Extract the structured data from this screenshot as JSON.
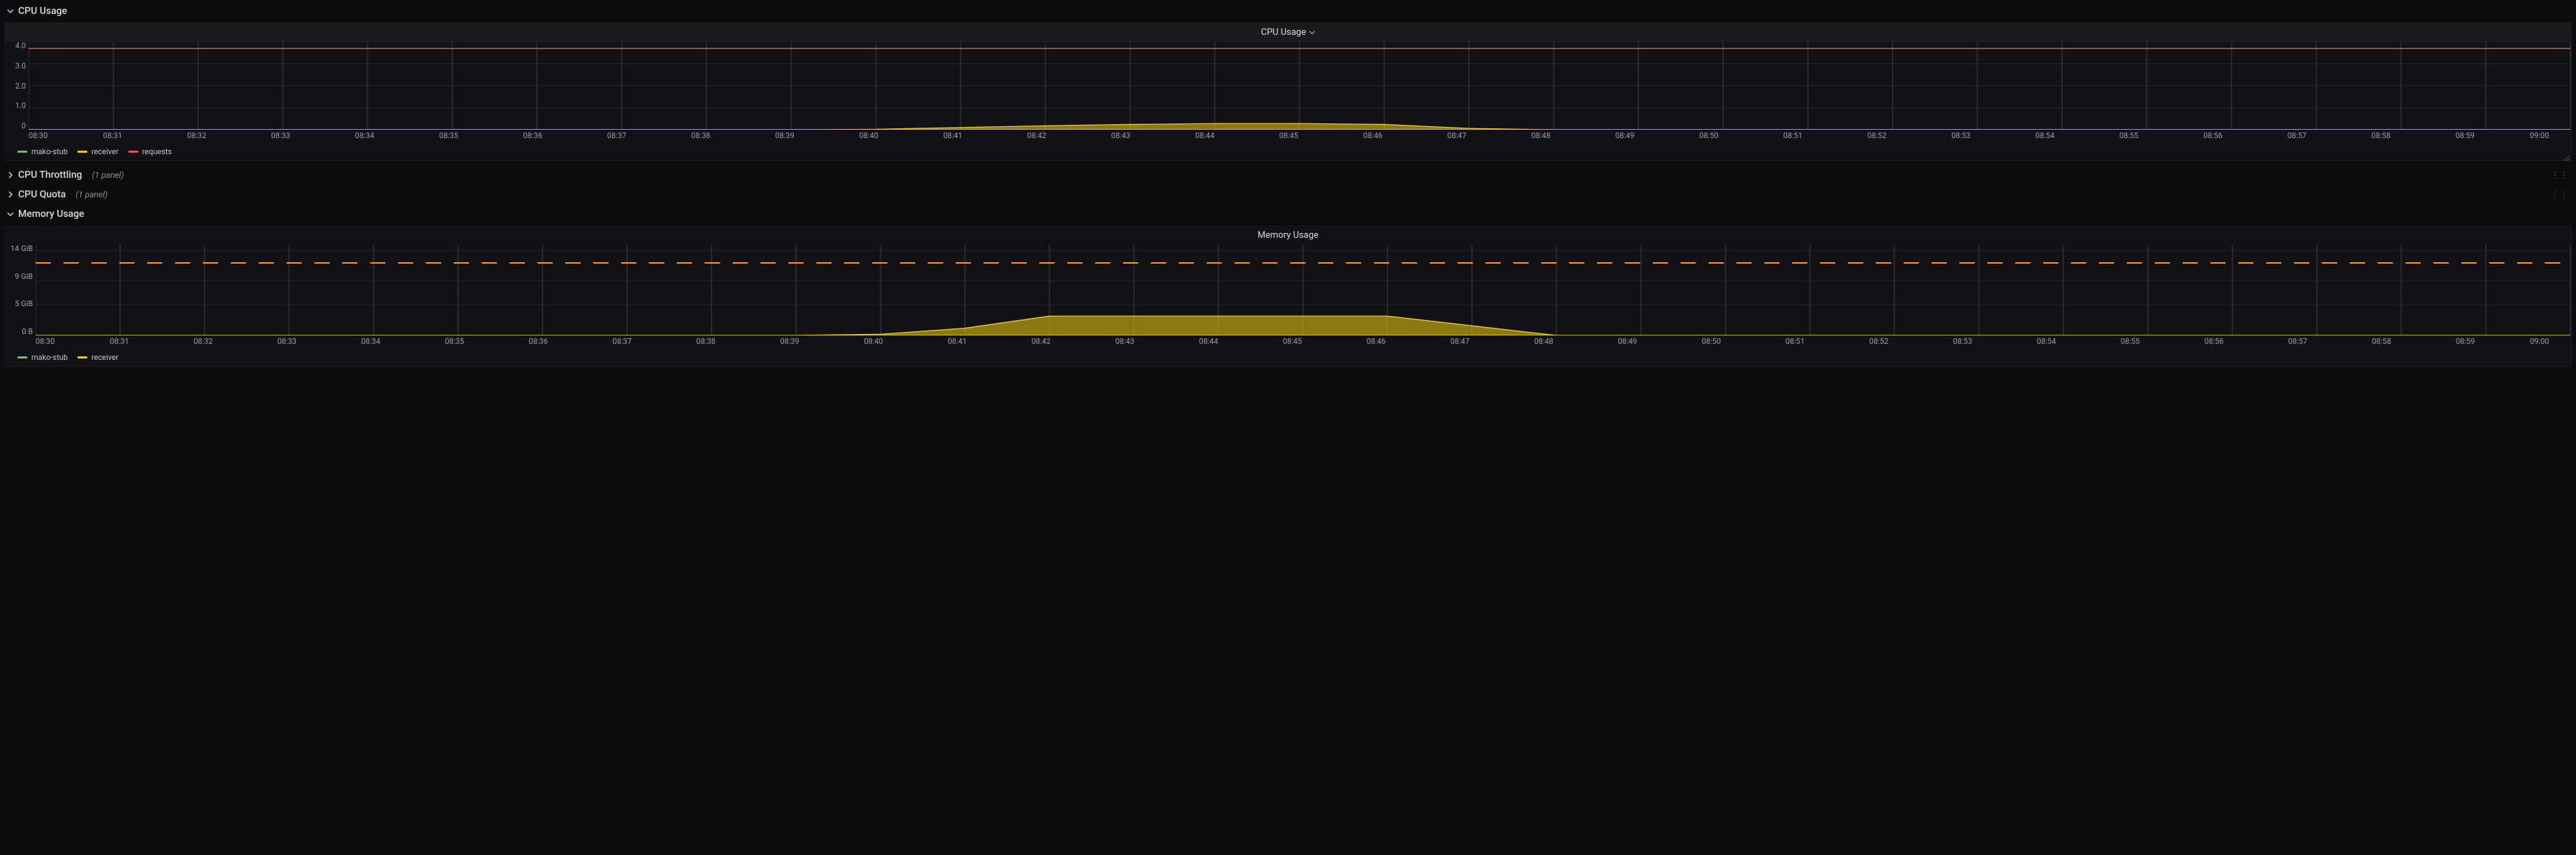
{
  "colors": {
    "green": "#73bf69",
    "yellow": "#f2cc0c",
    "red": "#f2495c",
    "orange": "#ff9830",
    "grid": "#2c2d31"
  },
  "rows": {
    "cpu_usage": {
      "title": "CPU Usage",
      "expanded": true
    },
    "cpu_throttling": {
      "title": "CPU Throttling",
      "expanded": false,
      "panel_count": "(1 panel)"
    },
    "cpu_quota": {
      "title": "CPU Quota",
      "expanded": false,
      "panel_count": "(1 panel)"
    },
    "memory_usage": {
      "title": "Memory Usage",
      "expanded": true
    }
  },
  "panels": {
    "cpu": {
      "title": "CPU Usage",
      "yticks": [
        "4.0",
        "3.0",
        "2.0",
        "1.0",
        "0"
      ],
      "legend": [
        {
          "key": "mako_stub",
          "label": "mako-stub",
          "color": "#73bf69"
        },
        {
          "key": "receiver",
          "label": "receiver",
          "color": "#f2cc0c"
        },
        {
          "key": "requests",
          "label": "requests",
          "color": "#f2495c"
        }
      ]
    },
    "memory": {
      "title": "Memory Usage",
      "yticks": [
        "14 GiB",
        "9 GiB",
        "5 GiB",
        "0 B"
      ],
      "legend": [
        {
          "key": "mako_stub",
          "label": "mako-stub",
          "color": "#73bf69"
        },
        {
          "key": "receiver",
          "label": "receiver",
          "color": "#f2cc0c"
        }
      ]
    }
  },
  "xticks": [
    "08:30",
    "08:31",
    "08:32",
    "08:33",
    "08:34",
    "08:35",
    "08:36",
    "08:37",
    "08:38",
    "08:39",
    "08:40",
    "08:41",
    "08:42",
    "08:43",
    "08:44",
    "08:45",
    "08:46",
    "08:47",
    "08:48",
    "08:49",
    "08:50",
    "08:51",
    "08:52",
    "08:53",
    "08:54",
    "08:55",
    "08:56",
    "08:57",
    "08:58",
    "08:59",
    "09:00"
  ],
  "chart_data": [
    {
      "type": "line",
      "title": "CPU Usage",
      "xlabel": "",
      "ylabel": "",
      "ylim": [
        0,
        4.0
      ],
      "yticks": [
        0,
        1.0,
        2.0,
        3.0,
        4.0
      ],
      "x": [
        "08:30",
        "08:31",
        "08:32",
        "08:33",
        "08:34",
        "08:35",
        "08:36",
        "08:37",
        "08:38",
        "08:39",
        "08:40",
        "08:41",
        "08:42",
        "08:43",
        "08:44",
        "08:45",
        "08:46",
        "08:47",
        "08:48",
        "08:49",
        "08:50",
        "08:51",
        "08:52",
        "08:53",
        "08:54",
        "08:55",
        "08:56",
        "08:57",
        "08:58",
        "08:59",
        "09:00"
      ],
      "series": [
        {
          "name": "mako-stub",
          "color": "#73bf69",
          "values": [
            0,
            0,
            0,
            0,
            0,
            0,
            0,
            0,
            0,
            0,
            0,
            0,
            0,
            0,
            0,
            0,
            0,
            0,
            0,
            0,
            0,
            0,
            0,
            0,
            0,
            0,
            0,
            0,
            0,
            0,
            0
          ]
        },
        {
          "name": "receiver",
          "color": "#f2cc0c",
          "fill": true,
          "values": [
            0,
            0,
            0,
            0,
            0,
            0,
            0,
            0,
            0,
            0,
            0.02,
            0.1,
            0.18,
            0.24,
            0.28,
            0.28,
            0.24,
            0.06,
            0,
            0,
            0,
            0,
            0,
            0,
            0,
            0,
            0,
            0,
            0,
            0,
            0
          ]
        },
        {
          "name": "requests",
          "color": "#f2495c",
          "constant": 3.7,
          "values": [
            3.7,
            3.7,
            3.7,
            3.7,
            3.7,
            3.7,
            3.7,
            3.7,
            3.7,
            3.7,
            3.7,
            3.7,
            3.7,
            3.7,
            3.7,
            3.7,
            3.7,
            3.7,
            3.7,
            3.7,
            3.7,
            3.7,
            3.7,
            3.7,
            3.7,
            3.7,
            3.7,
            3.7,
            3.7,
            3.7,
            3.7
          ]
        }
      ]
    },
    {
      "type": "area",
      "title": "Memory Usage",
      "xlabel": "",
      "ylabel": "",
      "ylim": [
        0,
        15
      ],
      "yticks_labels": [
        "0 B",
        "5 GiB",
        "9 GiB",
        "14 GiB"
      ],
      "yticks": [
        0,
        5,
        9,
        14
      ],
      "x": [
        "08:30",
        "08:31",
        "08:32",
        "08:33",
        "08:34",
        "08:35",
        "08:36",
        "08:37",
        "08:38",
        "08:39",
        "08:40",
        "08:41",
        "08:42",
        "08:43",
        "08:44",
        "08:45",
        "08:46",
        "08:47",
        "08:48",
        "08:49",
        "08:50",
        "08:51",
        "08:52",
        "08:53",
        "08:54",
        "08:55",
        "08:56",
        "08:57",
        "08:58",
        "08:59",
        "09:00"
      ],
      "reference_lines": [
        {
          "value": 12,
          "style": "dashed",
          "color": "#ff9830"
        }
      ],
      "series": [
        {
          "name": "mako-stub",
          "color": "#73bf69",
          "values": [
            0,
            0,
            0,
            0,
            0,
            0,
            0,
            0,
            0,
            0,
            0,
            0,
            0,
            0,
            0,
            0,
            0,
            0,
            0,
            0,
            0,
            0,
            0,
            0,
            0,
            0,
            0,
            0,
            0,
            0,
            0
          ]
        },
        {
          "name": "receiver",
          "color": "#f2cc0c",
          "fill": true,
          "values": [
            0,
            0,
            0,
            0,
            0,
            0,
            0,
            0,
            0,
            0,
            0.2,
            1.2,
            3.2,
            3.2,
            3.2,
            3.2,
            3.2,
            1.6,
            0,
            0,
            0,
            0,
            0,
            0,
            0,
            0,
            0,
            0,
            0,
            0,
            0
          ]
        }
      ]
    }
  ]
}
